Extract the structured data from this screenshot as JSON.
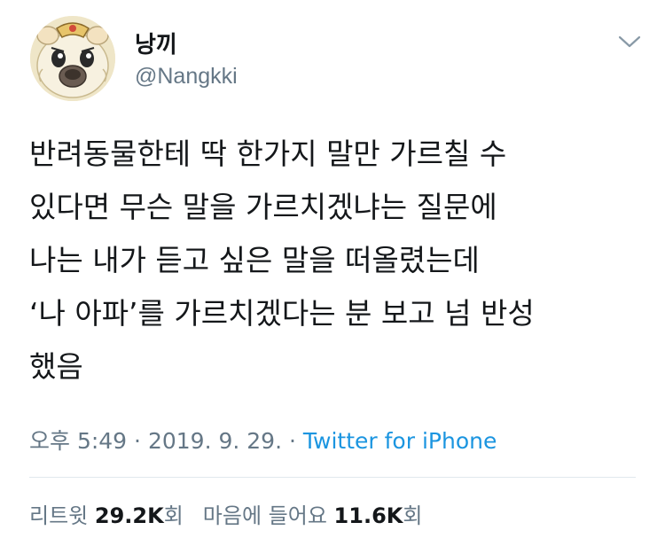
{
  "user": {
    "display_name": "낭끼",
    "handle": "@Nangkki",
    "avatar_icon": "cartoon-hamster-avatar"
  },
  "menu": {
    "icon": "chevron-down-icon"
  },
  "tweet": {
    "lines": [
      "반려동물한테 딱 한가지 말만 가르칠 수",
      "있다면 무슨 말을 가르치겠냐는 질문에",
      "나는 내가 듣고 싶은 말을 떠올렸는데",
      "‘나 아파’를 가르치겠다는 분 보고 넘 반성",
      "했음"
    ]
  },
  "meta": {
    "time": "오후 5:49",
    "separator1": "·",
    "date": "2019. 9. 29.",
    "separator2": "·",
    "source": "Twitter for iPhone"
  },
  "stats": {
    "retweet_label": "리트윗",
    "retweet_count": "29.2K",
    "retweet_suffix": "회",
    "like_label": "마음에 들어요",
    "like_count": "11.6K",
    "like_suffix": "회"
  },
  "colors": {
    "text": "#14171a",
    "secondary": "#657786",
    "link": "#1b95e0",
    "divider": "#e1e8ed"
  }
}
